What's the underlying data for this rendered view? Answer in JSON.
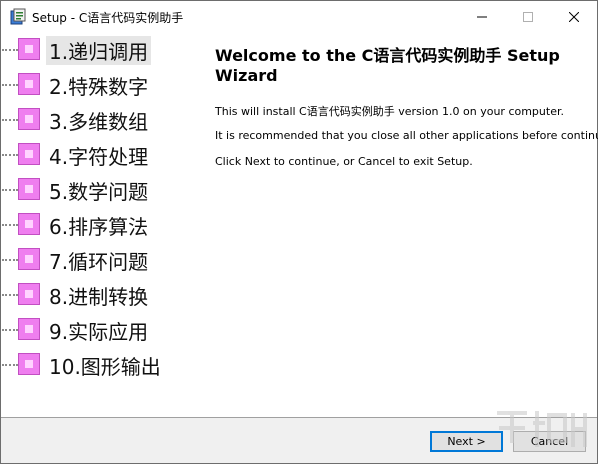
{
  "window": {
    "title": "Setup - C语言代码实例助手",
    "controls": {
      "minimize": "—",
      "maximize": "☐",
      "close": "✕"
    }
  },
  "sidebar": {
    "items": [
      {
        "label": "1.递归调用"
      },
      {
        "label": "2.特殊数字"
      },
      {
        "label": "3.多维数组"
      },
      {
        "label": "4.字符处理"
      },
      {
        "label": "5.数学问题"
      },
      {
        "label": "6.排序算法"
      },
      {
        "label": "7.循环问题"
      },
      {
        "label": "8.进制转换"
      },
      {
        "label": "9.实际应用"
      },
      {
        "label": "10.图形输出"
      }
    ]
  },
  "main": {
    "heading": "Welcome to the C语言代码实例助手 Setup Wizard",
    "paragraphs": [
      "This will install C语言代码实例助手 version 1.0 on your computer.",
      "It is recommended that you close all other applications before continuing.",
      "Click Next to continue, or Cancel to exit Setup."
    ]
  },
  "buttons": {
    "next": "Next >",
    "cancel": "Cancel"
  },
  "colors": {
    "node_fill": "#ef7eef",
    "accent": "#0078d7"
  }
}
